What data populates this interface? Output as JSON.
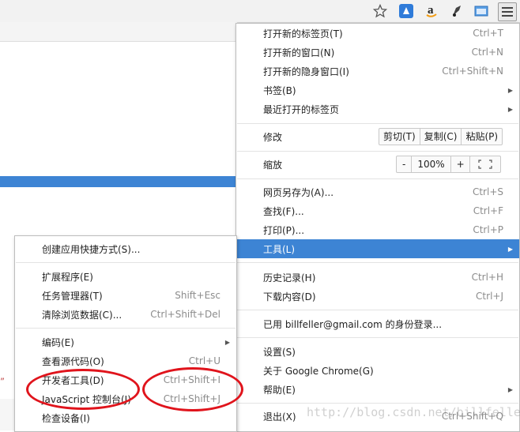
{
  "toolbar": {
    "icons": [
      "star-icon",
      "extension-blue-icon",
      "amazon-icon",
      "pen-tool-icon",
      "folder-window-icon",
      "hamburger-menu-icon"
    ],
    "amazon_glyph": "a"
  },
  "page_bg_text": "”",
  "main_menu": {
    "new_tab": {
      "label": "打开新的标签页(T)",
      "shortcut": "Ctrl+T"
    },
    "new_window": {
      "label": "打开新的窗口(N)",
      "shortcut": "Ctrl+N"
    },
    "new_incognito": {
      "label": "打开新的隐身窗口(I)",
      "shortcut": "Ctrl+Shift+N"
    },
    "bookmarks": {
      "label": "书签(B)"
    },
    "recent_tabs": {
      "label": "最近打开的标签页"
    },
    "edit": {
      "label": "修改",
      "cut": "剪切(T)",
      "copy": "复制(C)",
      "paste": "粘贴(P)"
    },
    "zoom": {
      "label": "缩放",
      "minus": "-",
      "value": "100%",
      "plus": "+"
    },
    "save_as": {
      "label": "网页另存为(A)...",
      "shortcut": "Ctrl+S"
    },
    "find": {
      "label": "查找(F)...",
      "shortcut": "Ctrl+F"
    },
    "print": {
      "label": "打印(P)...",
      "shortcut": "Ctrl+P"
    },
    "tools": {
      "label": "工具(L)"
    },
    "history": {
      "label": "历史记录(H)",
      "shortcut": "Ctrl+H"
    },
    "downloads": {
      "label": "下载内容(D)",
      "shortcut": "Ctrl+J"
    },
    "signed_in": {
      "label": "已用 billfeller@gmail.com 的身份登录..."
    },
    "settings": {
      "label": "设置(S)"
    },
    "about": {
      "label": "关于 Google Chrome(G)"
    },
    "help": {
      "label": "帮助(E)"
    },
    "exit": {
      "label": "退出(X)",
      "shortcut": "Ctrl+Shift+Q"
    }
  },
  "tools_menu": {
    "create_shortcuts": {
      "label": "创建应用快捷方式(S)..."
    },
    "extensions": {
      "label": "扩展程序(E)"
    },
    "task_manager": {
      "label": "任务管理器(T)",
      "shortcut": "Shift+Esc"
    },
    "clear_data": {
      "label": "清除浏览数据(C)...",
      "shortcut": "Ctrl+Shift+Del"
    },
    "encoding": {
      "label": "编码(E)"
    },
    "view_source": {
      "label": "查看源代码(O)",
      "shortcut": "Ctrl+U"
    },
    "dev_tools": {
      "label": "开发者工具(D)",
      "shortcut": "Ctrl+Shift+I"
    },
    "js_console": {
      "label": "JavaScript 控制台(J)",
      "shortcut": "Ctrl+Shift+J"
    },
    "inspect_devices": {
      "label": "检查设备(I)"
    }
  },
  "watermark": "http://blog.csdn.net/billfeller",
  "colors": {
    "highlight": "#3d84d4",
    "annotation_red": "#e0141c"
  }
}
